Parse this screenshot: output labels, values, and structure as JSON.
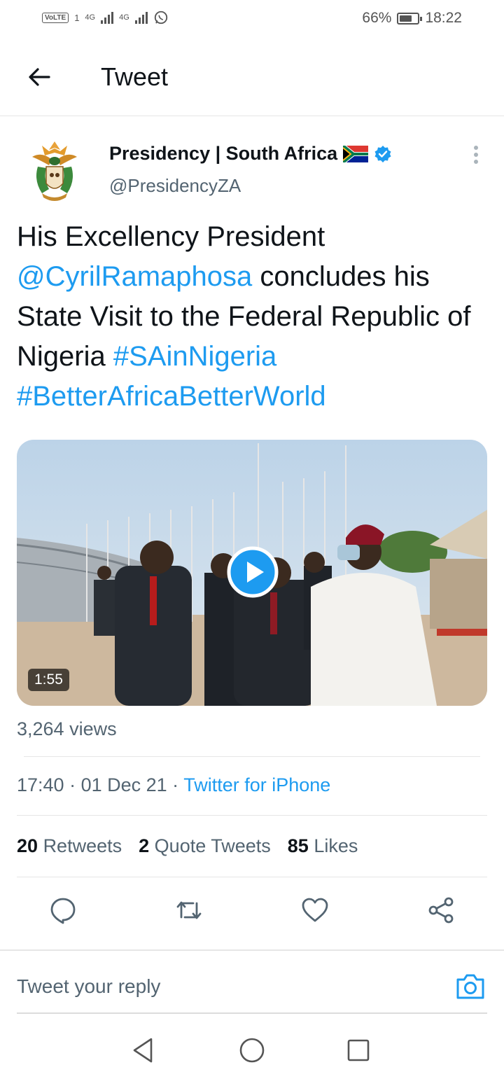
{
  "status_bar": {
    "volte": "VoLTE",
    "sim1": "1",
    "net1": "4G",
    "net2": "4G",
    "battery_percent": "66%",
    "battery_level": 0.66,
    "time": "18:22",
    "icons": [
      "whatsapp-icon",
      "battery-icon"
    ]
  },
  "header": {
    "title": "Tweet",
    "back_icon": "back-arrow-icon"
  },
  "tweet": {
    "author": {
      "display_name": "Presidency | South Africa",
      "handle": "@PresidencyZA",
      "verified": true,
      "avatar_icon": "coat-of-arms-icon",
      "flag_icon": "south-africa-flag-icon"
    },
    "text": {
      "part1": "His Excellency President ",
      "mention": "@CyrilRamaphosa",
      "part2": " concludes his State Visit to the Federal Republic of Nigeria ",
      "hashtag1": "#SAinNigeria",
      "hashtag2": "#BetterAfricaBetterWorld"
    },
    "media": {
      "type": "video",
      "duration": "1:55",
      "play_icon": "play-icon"
    },
    "views": "3,264 views",
    "time": "17:40",
    "separator": " · ",
    "date": "01 Dec 21",
    "source": "Twitter for iPhone",
    "stats": {
      "retweets_count": "20",
      "retweets_label": "Retweets",
      "quotes_count": "2",
      "quotes_label": "Quote Tweets",
      "likes_count": "85",
      "likes_label": "Likes"
    },
    "actions": [
      "reply-icon",
      "retweet-icon",
      "like-icon",
      "share-icon"
    ]
  },
  "reply_bar": {
    "placeholder": "Tweet your reply",
    "camera_icon": "camera-icon"
  },
  "nav_bar": [
    "back-nav-icon",
    "home-nav-icon",
    "recents-nav-icon"
  ],
  "colors": {
    "link": "#1d9bf0",
    "text": "#0f1419",
    "secondary": "#536471"
  }
}
